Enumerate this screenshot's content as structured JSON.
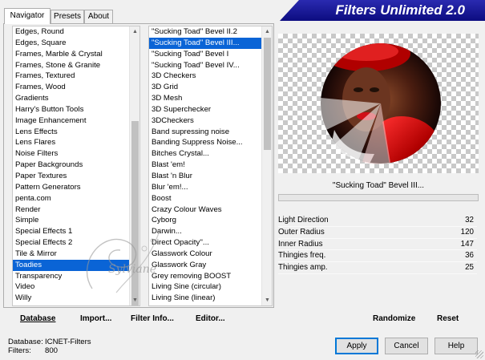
{
  "header": {
    "title": "Filters Unlimited 2.0"
  },
  "tabs": [
    {
      "label": "Navigator",
      "active": true
    },
    {
      "label": "Presets",
      "active": false
    },
    {
      "label": "About",
      "active": false
    }
  ],
  "categories": [
    "Edges, Round",
    "Edges, Square",
    "Frames, Marble & Crystal",
    "Frames, Stone & Granite",
    "Frames, Textured",
    "Frames, Wood",
    "Gradients",
    "Harry's Button Tools",
    "Image Enhancement",
    "Lens Effects",
    "Lens Flares",
    "Noise Filters",
    "Paper Backgrounds",
    "Paper Textures",
    "Pattern Generators",
    "penta.com",
    "Render",
    "Simple",
    "Special Effects 1",
    "Special Effects 2",
    "Tile & Mirror",
    "Toadies",
    "Transparency",
    "Video",
    "Willy"
  ],
  "selected_category": "Toadies",
  "filters": [
    "\"Sucking Toad\" Bevel II.2",
    "\"Sucking Toad\" Bevel III...",
    "\"Sucking Toad\" Bevel I",
    "\"Sucking Toad\" Bevel IV...",
    "3D Checkers",
    "3D Grid",
    "3D Mesh",
    "3D Superchecker",
    "3DCheckers",
    "Band supressing noise",
    "Banding Suppress Noise...",
    "Bitches Crystal...",
    "Blast 'em!",
    "Blast 'n Blur",
    "Blur 'em!...",
    "Boost",
    "Crazy Colour Waves",
    "Cyborg",
    "Darwin...",
    "Direct Opacity''...",
    "Glasswork Colour",
    "Glasswork Gray",
    "Grey removing BOOST",
    "Living Sine (circular)",
    "Living Sine (linear)"
  ],
  "selected_filter": "\"Sucking Toad\" Bevel III...",
  "preview": {
    "filter_name": "\"Sucking Toad\" Bevel III...",
    "watermark": "Sylviane"
  },
  "params": [
    {
      "name": "Light Direction",
      "value": "32"
    },
    {
      "name": "Outer Radius",
      "value": "120"
    },
    {
      "name": "Inner Radius",
      "value": "147"
    },
    {
      "name": "Thingies freq.",
      "value": "36"
    },
    {
      "name": "Thingies amp.",
      "value": "25"
    }
  ],
  "left_buttons": {
    "database": "Database",
    "import": "Import...",
    "filter_info": "Filter Info...",
    "editor": "Editor..."
  },
  "right_buttons": {
    "randomize": "Randomize",
    "reset": "Reset"
  },
  "info": {
    "database_label": "Database:",
    "database_value": "ICNET-Filters",
    "filters_label": "Filters:",
    "filters_value": "800"
  },
  "dialog_buttons": {
    "apply": "Apply",
    "cancel": "Cancel",
    "help": "Help"
  },
  "colors": {
    "banner": "#10108a",
    "selection": "#0a64d6"
  }
}
